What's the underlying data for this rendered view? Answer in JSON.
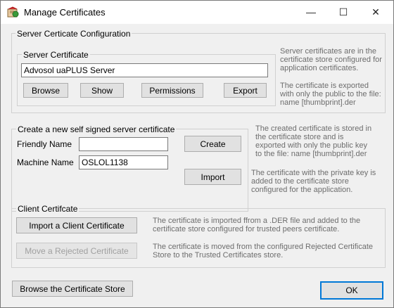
{
  "window": {
    "title": "Manage Certificates",
    "minimize_glyph": "—",
    "maximize_glyph": "☐",
    "close_glyph": "✕",
    "icon": "certificate-app-icon"
  },
  "server_config": {
    "group_label": "Server Certicate Configuration",
    "server_cert": {
      "group_label": "Server Certificate",
      "value": "Advosol uaPLUS Server",
      "buttons": {
        "browse": "Browse",
        "show": "Show",
        "permissions": "Permissions",
        "export": "Export"
      }
    },
    "note_store": "Server certificates are in the certificate store configured for application certificates.",
    "note_export": "The certificate is exported with only the public to the file: name [thumbprint].der"
  },
  "self_signed": {
    "group_label": "Create a new self signed server certificate",
    "friendly_name_label": "Friendly Name",
    "friendly_name_value": "",
    "machine_name_label": "Machine Name",
    "machine_name_value": "OSLOL1138",
    "create_label": "Create",
    "import_label": "Import",
    "note_create": "The created certificate is stored in the certificate store and is exported with only the public key to the file: name [thumbprint].der",
    "note_import": "The certificate with the private key is added to the certificate store configured for the application."
  },
  "client": {
    "group_label": "Client Certifcate",
    "import_label": "Import a Client Certificate",
    "move_label": "Move a Rejected Certificate",
    "note_import": "The certificate is imported ffrom a .DER file and added to the certificate store configured for trusted peers certificate.",
    "note_move": "The certificate is moved from the configured Rejected Certificate Store to the Trusted Certificates store."
  },
  "footer": {
    "browse_store_label": "Browse the Certificate Store",
    "ok_label": "OK"
  }
}
